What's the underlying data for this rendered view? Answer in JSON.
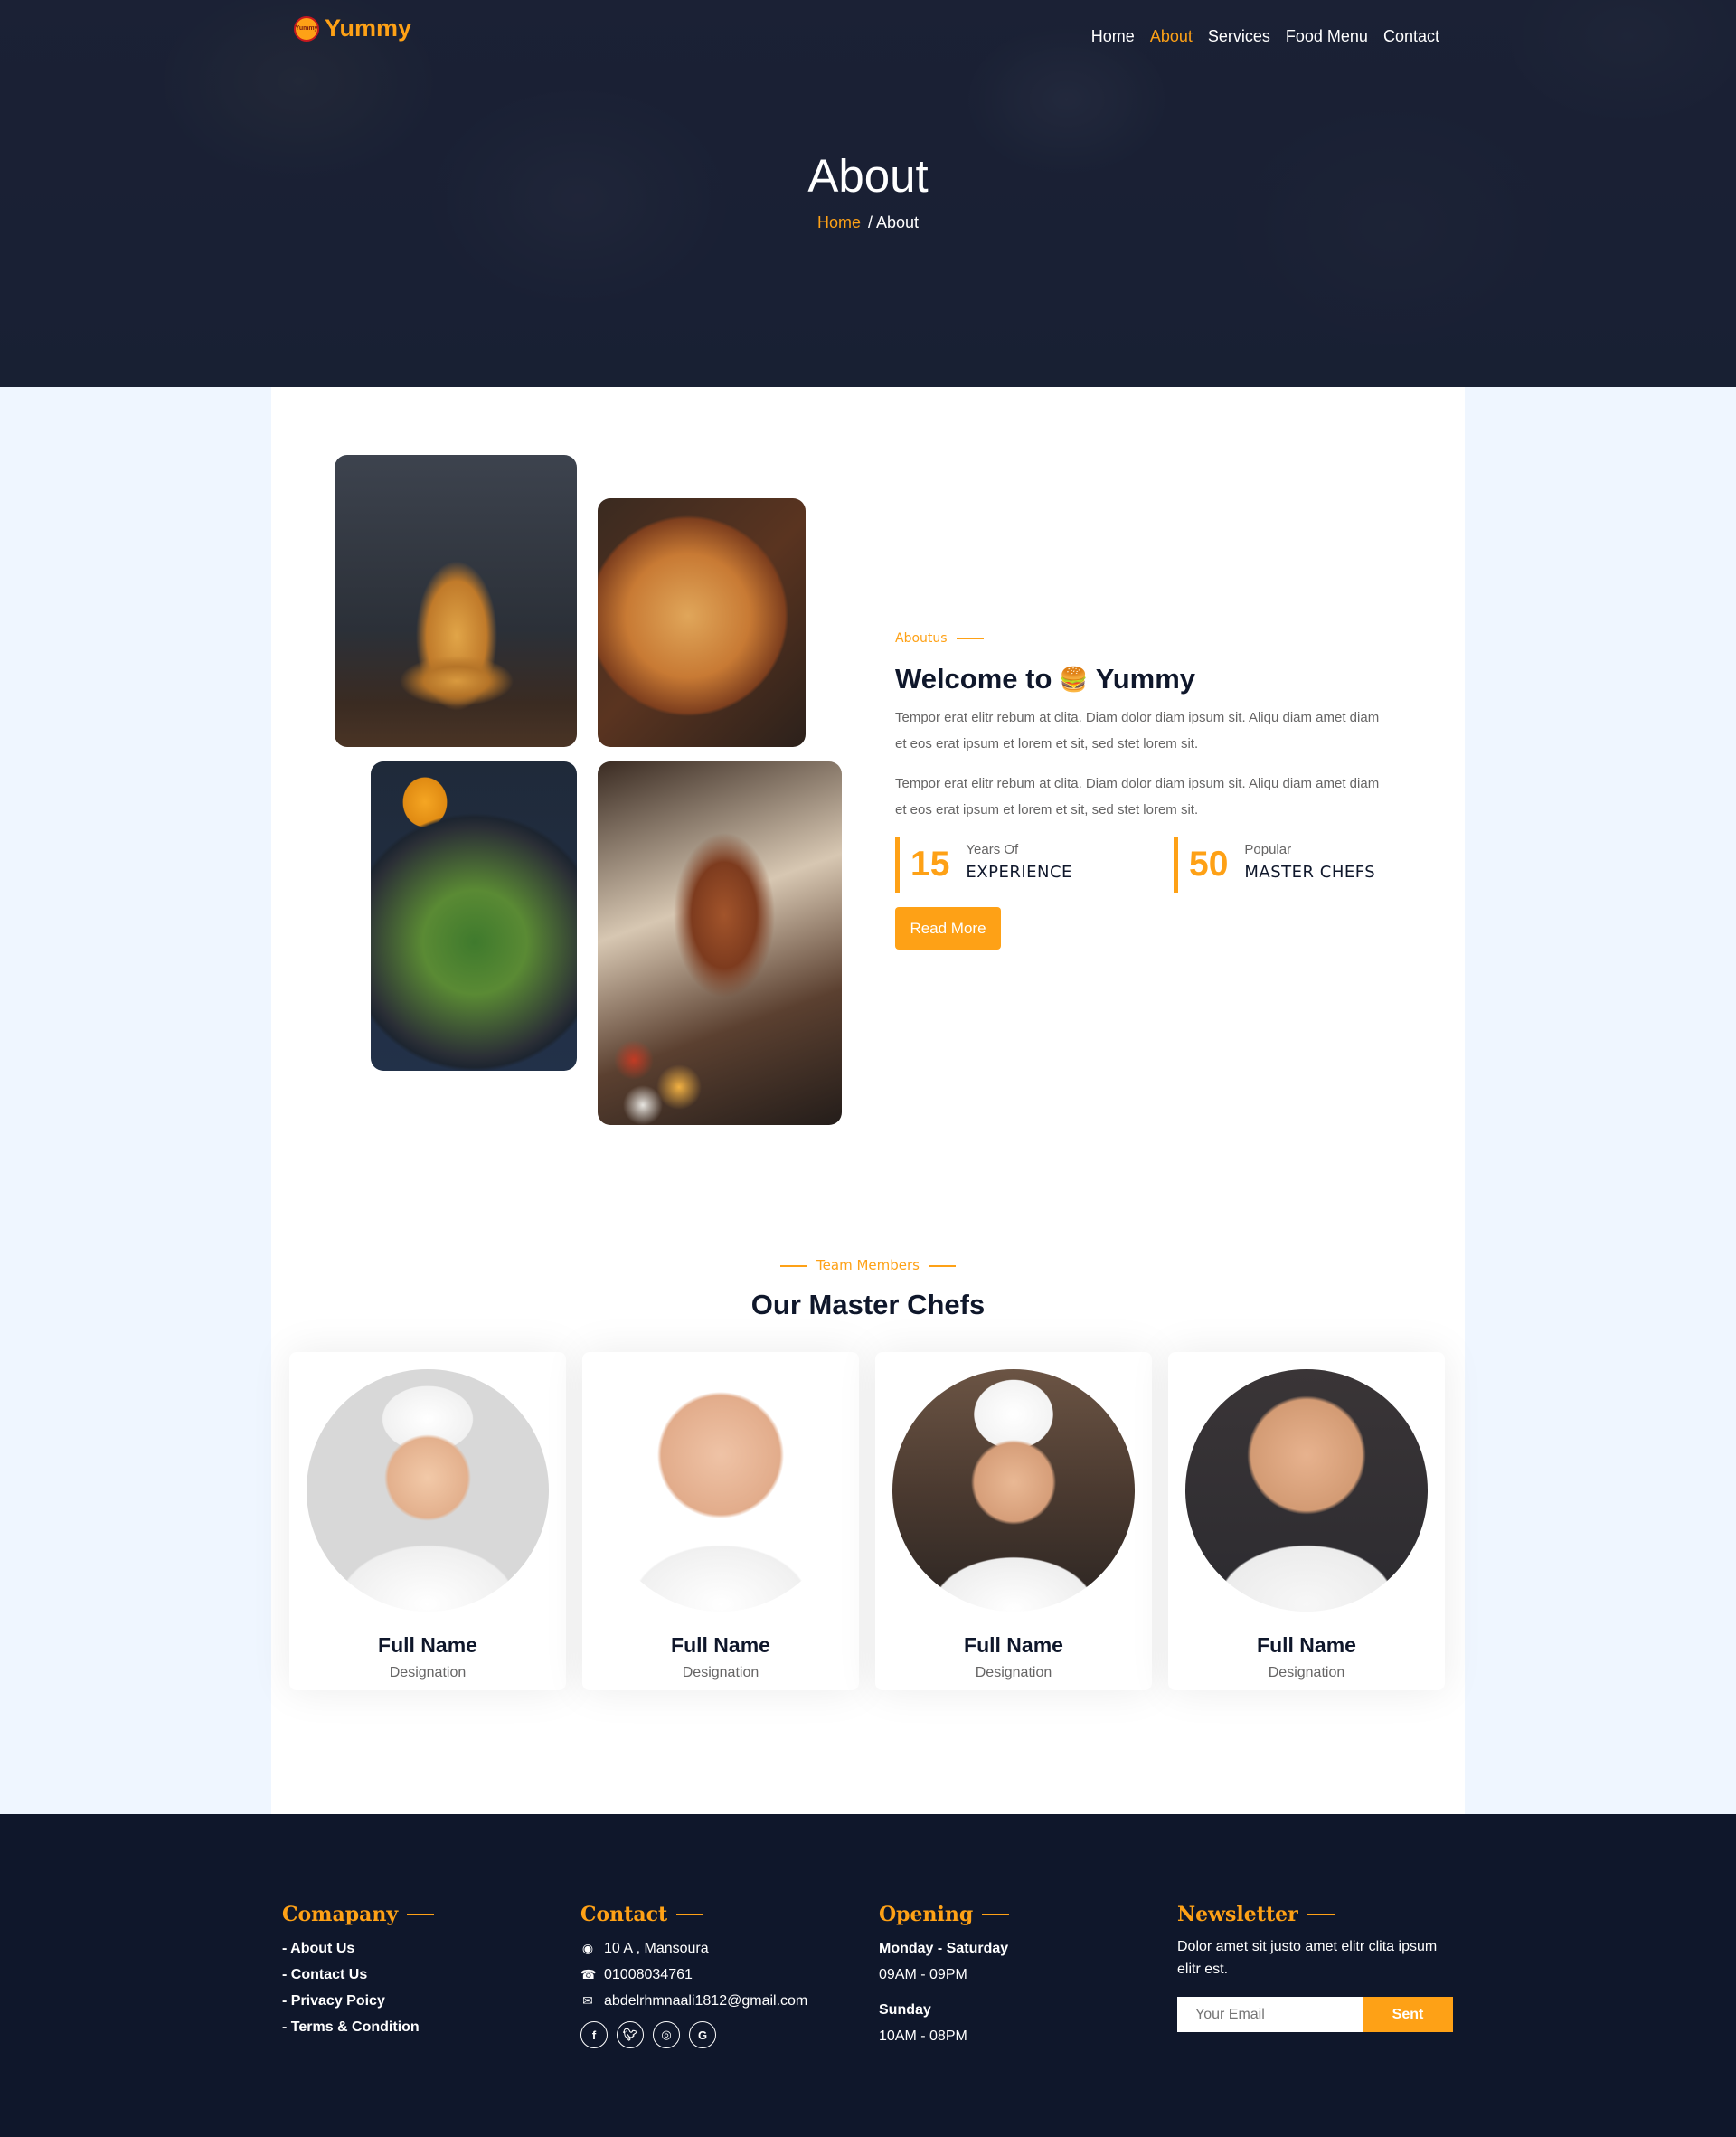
{
  "brand": {
    "name": "Yummy",
    "badge": "Yummy"
  },
  "nav": [
    "Home",
    "About",
    "Services",
    "Food Menu",
    "Contact"
  ],
  "nav_active": "About",
  "hero": {
    "title": "About",
    "breadcrumb_home": "Home",
    "breadcrumb_sep": "/",
    "breadcrumb_current": "About"
  },
  "about": {
    "subtitle": "Aboutus",
    "title_prefix": "Welcome to",
    "title_brand": "Yummy",
    "p1": "Tempor erat elitr rebum at clita. Diam dolor diam ipsum sit. Aliqu diam amet diam et eos erat ipsum et lorem et sit, sed stet lorem sit.",
    "p2": "Tempor erat elitr rebum at clita. Diam dolor diam ipsum sit. Aliqu diam amet diam et eos erat ipsum et lorem et sit, sed stet lorem sit.",
    "stats": [
      {
        "num": "15",
        "small": "Years Of",
        "big": "EXPERIENCE"
      },
      {
        "num": "50",
        "small": "Popular",
        "big": "MASTER CHEFS"
      }
    ],
    "button": "Read More"
  },
  "team": {
    "subtitle": "Team Members",
    "title": "Our Master Chefs",
    "members": [
      {
        "name": "Full Name",
        "role": "Designation"
      },
      {
        "name": "Full Name",
        "role": "Designation"
      },
      {
        "name": "Full Name",
        "role": "Designation"
      },
      {
        "name": "Full Name",
        "role": "Designation"
      }
    ]
  },
  "footer": {
    "company": {
      "title": "Comapany",
      "links": [
        "- About Us",
        "- Contact Us",
        "- Privacy Poicy",
        "- Terms & Condition"
      ]
    },
    "contact": {
      "title": "Contact",
      "address": "10 A , Mansoura",
      "phone": "01008034761",
      "email": "abdelrhmnaali1812@gmail.com"
    },
    "opening": {
      "title": "Opening",
      "days1": "Monday - Saturday",
      "hours1": "09AM - 09PM",
      "days2": "Sunday",
      "hours2": "10AM - 08PM"
    },
    "newsletter": {
      "title": "Newsletter",
      "desc": "Dolor amet sit justo amet elitr clita ipsum elitr est.",
      "placeholder": "Your Email",
      "button": "Sent"
    }
  },
  "icons": {
    "address": "map-marker-icon",
    "phone": "phone-icon",
    "email": "envelope-icon",
    "socials": [
      "facebook-icon",
      "twitter-icon",
      "instagram-icon",
      "google-icon"
    ]
  },
  "colors": {
    "accent": "#fea116",
    "dark": "#0f172b",
    "text": "#666565",
    "panel_bg": "#eff6ff"
  }
}
